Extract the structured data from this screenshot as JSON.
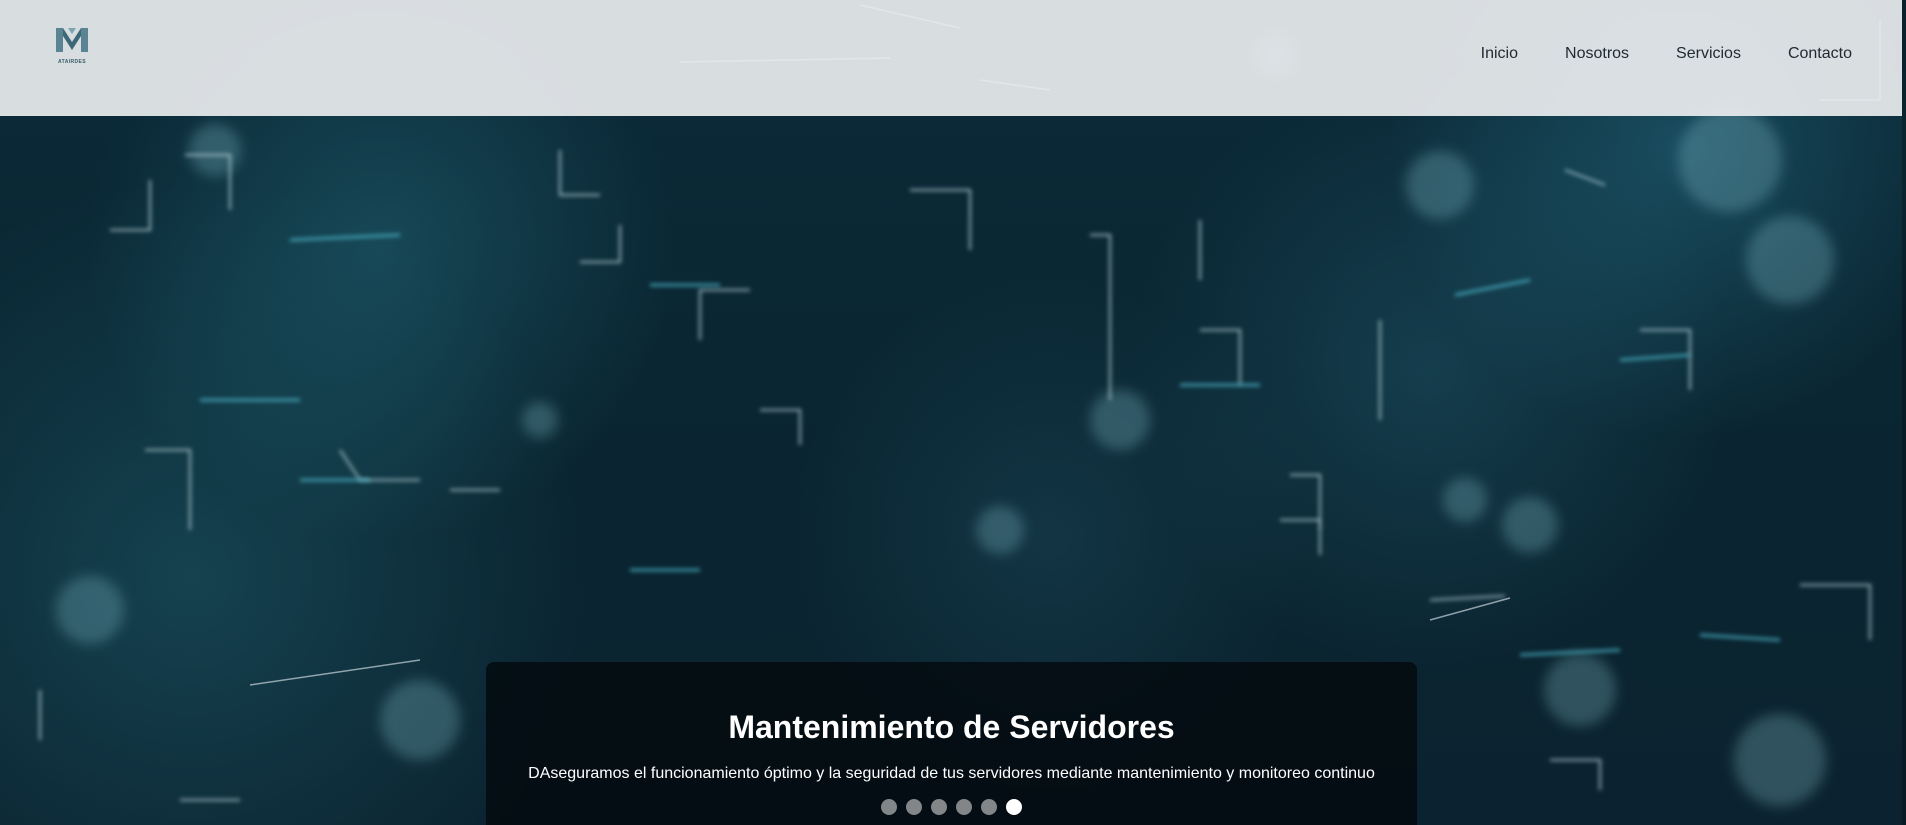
{
  "brand": {
    "logo_text": "ATAIRDES"
  },
  "nav": {
    "items": [
      "Inicio",
      "Nosotros",
      "Servicios",
      "Contacto"
    ]
  },
  "slider": {
    "title": "Mantenimiento de Servidores",
    "description": "DAseguramos el funcionamiento óptimo y la seguridad de tus servidores mediante mantenimiento y monitoreo continuo",
    "total_slides": 6,
    "active_slide": 6
  },
  "colors": {
    "accent": "#4fb8c9",
    "header_bg": "#eaedef",
    "caption_bg": "#02080c"
  }
}
